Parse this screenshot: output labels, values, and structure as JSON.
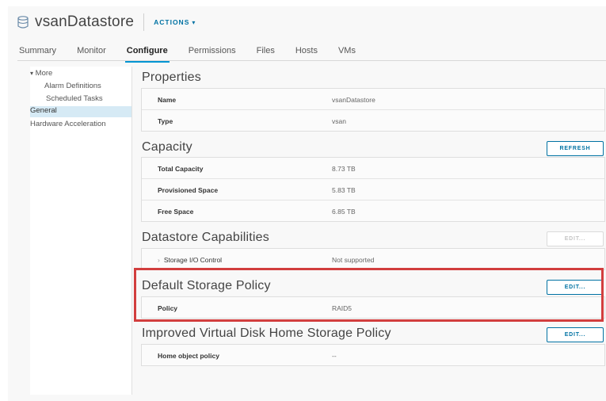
{
  "header": {
    "title": "vsanDatastore",
    "actions_label": "ACTIONS",
    "icon": "datastore-icon"
  },
  "tabs": [
    {
      "label": "Summary",
      "active": false
    },
    {
      "label": "Monitor",
      "active": false
    },
    {
      "label": "Configure",
      "active": true
    },
    {
      "label": "Permissions",
      "active": false
    },
    {
      "label": "Files",
      "active": false
    },
    {
      "label": "Hosts",
      "active": false
    },
    {
      "label": "VMs",
      "active": false
    }
  ],
  "sidebar": {
    "group_label": "More",
    "items": [
      {
        "label": "Alarm Definitions"
      },
      {
        "label": "Scheduled Tasks"
      },
      {
        "label": "General",
        "selected": true
      },
      {
        "label": "Hardware Acceleration"
      }
    ]
  },
  "properties": {
    "title": "Properties",
    "rows": [
      {
        "key": "Name",
        "value": "vsanDatastore"
      },
      {
        "key": "Type",
        "value": "vsan"
      }
    ]
  },
  "capacity": {
    "title": "Capacity",
    "refresh_label": "REFRESH",
    "rows": [
      {
        "key": "Total Capacity",
        "value": "8.73 TB"
      },
      {
        "key": "Provisioned Space",
        "value": "5.83 TB"
      },
      {
        "key": "Free Space",
        "value": "6.85 TB"
      }
    ]
  },
  "capabilities": {
    "title": "Datastore Capabilities",
    "edit_label": "EDIT...",
    "rows": [
      {
        "key": "Storage I/O Control",
        "value": "Not supported"
      }
    ]
  },
  "default_policy": {
    "title": "Default Storage Policy",
    "edit_label": "EDIT...",
    "rows": [
      {
        "key": "Policy",
        "value": "RAID5"
      }
    ]
  },
  "home_policy": {
    "title": "Improved Virtual Disk Home Storage Policy",
    "edit_label": "EDIT...",
    "rows": [
      {
        "key": "Home object policy",
        "value": "--"
      }
    ]
  },
  "colors": {
    "accent": "#0072a3",
    "tab_underline": "#0095d3",
    "highlight": "#d23e3e",
    "selected_bg": "#d6eaf5"
  }
}
